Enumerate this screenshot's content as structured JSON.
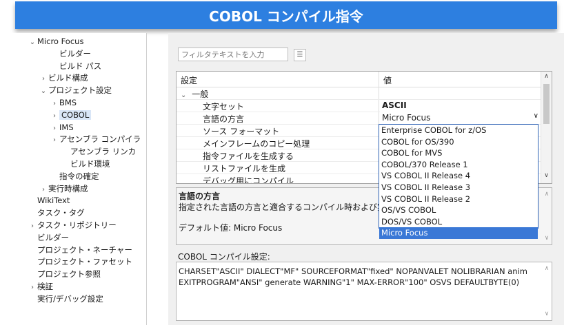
{
  "banner": {
    "title": "COBOL コンパイル指令"
  },
  "tree": [
    {
      "label": "Micro Focus",
      "chevron": "down",
      "indent": 0
    },
    {
      "label": "ビルダー",
      "chevron": "",
      "indent": 2
    },
    {
      "label": "ビルド パス",
      "chevron": "",
      "indent": 2
    },
    {
      "label": "ビルド構成",
      "chevron": "right",
      "indent": 1
    },
    {
      "label": "プロジェクト設定",
      "chevron": "down",
      "indent": 1
    },
    {
      "label": "BMS",
      "chevron": "right",
      "indent": 2
    },
    {
      "label": "COBOL",
      "chevron": "right",
      "indent": 2,
      "selected": true
    },
    {
      "label": "IMS",
      "chevron": "right",
      "indent": 2
    },
    {
      "label": "アセンブラ コンパイラ",
      "chevron": "right",
      "indent": 2
    },
    {
      "label": "アセンブラ リンカ",
      "chevron": "",
      "indent": 3
    },
    {
      "label": "ビルド環境",
      "chevron": "",
      "indent": 3
    },
    {
      "label": "指令の確定",
      "chevron": "",
      "indent": 2
    },
    {
      "label": "実行時構成",
      "chevron": "right",
      "indent": 1
    },
    {
      "label": "WikiText",
      "chevron": "",
      "indent": 0
    },
    {
      "label": "タスク・タグ",
      "chevron": "",
      "indent": 0
    },
    {
      "label": "タスク・リポジトリー",
      "chevron": "right",
      "indent": 0
    },
    {
      "label": "ビルダー",
      "chevron": "",
      "indent": 0
    },
    {
      "label": "プロジェクト・ネーチャー",
      "chevron": "",
      "indent": 0
    },
    {
      "label": "プロジェクト・ファセット",
      "chevron": "",
      "indent": 0
    },
    {
      "label": "プロジェクト参照",
      "chevron": "",
      "indent": 0
    },
    {
      "label": "検証",
      "chevron": "right",
      "indent": 0
    },
    {
      "label": "実行/デバッグ設定",
      "chevron": "",
      "indent": 0
    }
  ],
  "filter": {
    "placeholder": "フィルタテキストを入力"
  },
  "table": {
    "col_setting": "設定",
    "col_value": "値",
    "group": "一般",
    "rows": [
      {
        "key": "文字セット",
        "value": "ASCII"
      },
      {
        "key": "言語の方言",
        "value": "Micro Focus"
      },
      {
        "key": "ソース フォーマット",
        "value": ""
      },
      {
        "key": "メインフレームのコピー処理",
        "value": ""
      },
      {
        "key": "指令ファイルを生成する",
        "value": ""
      },
      {
        "key": "リストファイルを生成",
        "value": ""
      },
      {
        "key": "デバッグ用にコンパイル",
        "value": ""
      }
    ]
  },
  "dropdown": {
    "options": [
      "Enterprise COBOL for z/OS",
      "COBOL for OS/390",
      "COBOL for MVS",
      "COBOL/370 Release 1",
      "VS COBOL II Release 4",
      "VS COBOL II Release 3",
      "VS COBOL II Release 2",
      "OS/VS COBOL",
      "DOS/VS COBOL",
      "Micro Focus"
    ],
    "selected_index": 9
  },
  "description": {
    "title": "言語の方言",
    "text": "指定された言語の方言と適合するコンパイル時および実行時の",
    "default": "デフォルト値: Micro Focus"
  },
  "settings": {
    "label": "COBOL コンパイル設定:",
    "line1": "CHARSET\"ASCII\" DIALECT\"MF\" SOURCEFORMAT\"fixed\" NOPANVALET NOLIBRARIAN anim",
    "line2": "EXITPROGRAM\"ANSI\" generate WARNING\"1\" MAX-ERROR\"100\" OSVS DEFAULTBYTE(0)"
  }
}
